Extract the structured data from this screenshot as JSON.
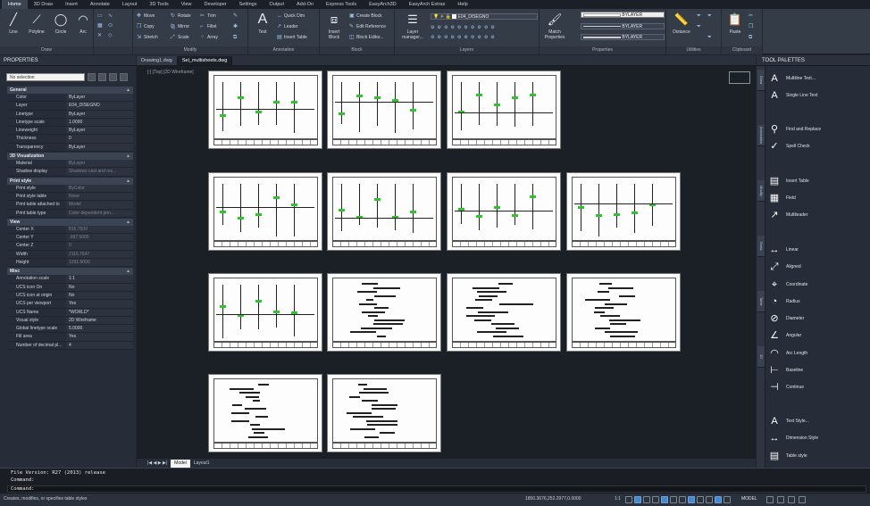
{
  "menu": [
    "Home",
    "3D Draw",
    "Insert",
    "Annotate",
    "Layout",
    "3D Tools",
    "View",
    "Developer",
    "Settings",
    "Output",
    "Add-On",
    "Express Tools",
    "EasyArch3D",
    "EasyArch Extras",
    "Help"
  ],
  "ribbon": {
    "draw": {
      "title": "Draw",
      "line": "Line",
      "polyline": "Polyline",
      "circle": "Circle",
      "arc": "Arc"
    },
    "modify": {
      "title": "Modify",
      "move": "Move",
      "copy": "Copy",
      "stretch": "Stretch",
      "rotate": "Rotate",
      "mirror": "Mirror",
      "scale": "Scale",
      "trim": "Trim",
      "fillet": "Fillet",
      "array": "Array"
    },
    "annotation": {
      "title": "Annotation",
      "text": "Text",
      "quick_dim": "Quick Dim",
      "leader": "Leader",
      "insert_table": "Insert Table"
    },
    "block": {
      "title": "Block",
      "insert_block": "Insert Block",
      "create_block": "Create Block",
      "edit_reference": "Edit Reference",
      "block_editor": "Block Editor..."
    },
    "layers": {
      "title": "Layers",
      "layer_manager": "Layer manager...",
      "current_layer": "E04_DISEGNO"
    },
    "properties": {
      "title": "Properties",
      "match": "Match Properties",
      "color": "BYLAYER",
      "linetype": "BYLAYER",
      "lineweight": "BYLAYER"
    },
    "utilities": {
      "title": "Utilities",
      "distance": "Distance"
    },
    "clipboard": {
      "title": "Clipboard",
      "paste": "Paste"
    }
  },
  "properties_panel": {
    "title": "PROPERTIES",
    "selection": "No selection",
    "sections": [
      {
        "name": "General",
        "rows": [
          [
            "Color",
            "ByLayer"
          ],
          [
            "Layer",
            "E04_DISEGNO"
          ],
          [
            "Linetype",
            "ByLayer"
          ],
          [
            "Linetype scale",
            "1.0000"
          ],
          [
            "Lineweight",
            "ByLayer"
          ],
          [
            "Thickness",
            "0"
          ],
          [
            "Transparency",
            "ByLayer"
          ]
        ]
      },
      {
        "name": "3D Visualization",
        "rows": [
          [
            "Material",
            "ByLayer"
          ],
          [
            "Shadow display",
            "Shadows cast and rec..."
          ]
        ]
      },
      {
        "name": "Print style",
        "rows": [
          [
            "Print style",
            "ByColor"
          ],
          [
            "Print style table",
            "None"
          ],
          [
            "Print table attached to",
            "Model"
          ],
          [
            "Print table type",
            "Color-dependent prin..."
          ]
        ]
      },
      {
        "name": "View",
        "rows": [
          [
            "Center X",
            "815.7500"
          ],
          [
            "Center Y",
            "-387.5000"
          ],
          [
            "Center Z",
            "0"
          ],
          [
            "Width",
            "2115.7647"
          ],
          [
            "Height",
            "1291.5000"
          ]
        ]
      },
      {
        "name": "Misc",
        "rows": [
          [
            "Annotation scale",
            "1:1"
          ],
          [
            "UCS icon On",
            "No"
          ],
          [
            "UCS icon at origin",
            "No"
          ],
          [
            "UCS per viewport",
            "Yes"
          ],
          [
            "UCS Name",
            "*WORLD*"
          ],
          [
            "Visual style",
            "2D Wireframe"
          ],
          [
            "Global linetype scale",
            "5.0000"
          ],
          [
            "Fill area",
            "Yes"
          ],
          [
            "Number of decimal pl...",
            "4"
          ]
        ]
      }
    ]
  },
  "documents": {
    "tabs": [
      "Drawing1.dwg",
      "Sel_multisheets.dwg"
    ],
    "active": 1
  },
  "viewport_label": "[-] [Top] [2D Wireframe]",
  "layout_tabs": {
    "model": "Model",
    "layout1": "Layout1"
  },
  "tool_palettes": {
    "title": "TOOL PALETTES",
    "tabs": [
      "Draw",
      "Annotation",
      "Modify",
      "Draw",
      "Table",
      "3D"
    ],
    "items": [
      "Multiline Text...",
      "Single Line Text",
      "Find and Replace",
      "Spell Check",
      "Insert Table",
      "Field",
      "Multileader",
      "Linear",
      "Aligned",
      "Coordinate",
      "Radius",
      "Diameter",
      "Angular",
      "Arc Length",
      "Baseline",
      "Continue",
      "Text Style...",
      "Dimension Style",
      "Table style"
    ]
  },
  "command": {
    "history": [
      "File Version: R27 (2013) release",
      "Command:"
    ],
    "prompt": "Command:"
  },
  "status": {
    "help_text": "Creates, modifies, or specifies table styles",
    "coordinates": "1850.3676,252.2977,0.0000",
    "annotation_scale": "1:1",
    "mode": "MODEL"
  }
}
